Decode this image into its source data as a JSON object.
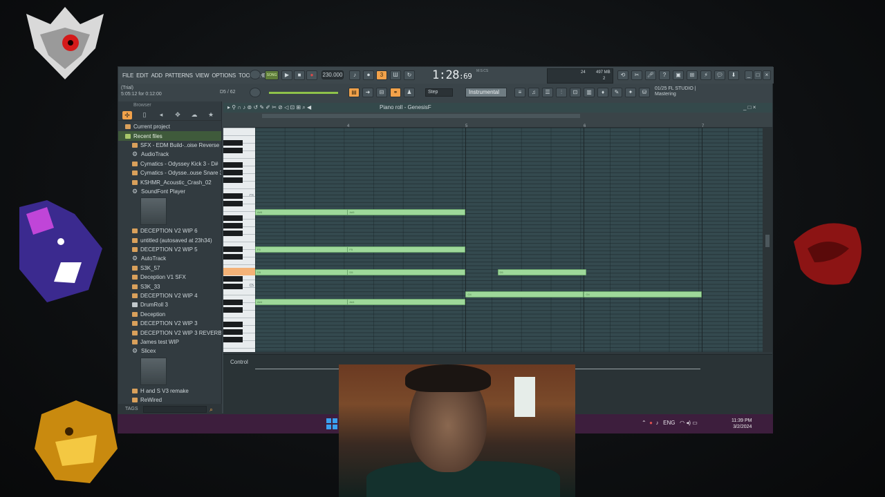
{
  "menu": [
    "FILE",
    "EDIT",
    "ADD",
    "PATTERNS",
    "VIEW",
    "OPTIONS",
    "TOOLS",
    "HELP"
  ],
  "hint": {
    "line1": "(Trial)",
    "line2": "5:05:12 for 0:12:00",
    "counter": "D5 / 62"
  },
  "transport": {
    "song_label": "SONG",
    "tempo": "230.000",
    "time": "1:28",
    "time_fraction": ":69",
    "time_unit": "M:S:CS",
    "cpu_value": "24",
    "memory": "497 MB",
    "voices": "2"
  },
  "toolbar": {
    "step_label": "Step",
    "channel_label": "Instrumental"
  },
  "fl_info": {
    "line1": "01/25  FL STUDIO |",
    "line2": "Mastering"
  },
  "browser": {
    "title": "Browser",
    "items": [
      {
        "type": "folder",
        "icon": "folder-icon",
        "label": "Current project"
      },
      {
        "type": "folder",
        "icon": "folder-green-icon",
        "label": "Recent files",
        "selected": true
      },
      {
        "type": "item",
        "icon": "audio-file-icon",
        "label": "SFX - EDM Build-..oise Reverse 160"
      },
      {
        "type": "item",
        "icon": "gear-icon",
        "label": "AudioTrack"
      },
      {
        "type": "item",
        "icon": "audio-file-icon",
        "label": "Cymatics - Odyssey Kick 3 - D#"
      },
      {
        "type": "item",
        "icon": "audio-file-icon",
        "label": "Cymatics - Odysse..ouse Snare 3 - E"
      },
      {
        "type": "item",
        "icon": "audio-file-icon",
        "label": "KSHMR_Acoustic_Crash_02"
      },
      {
        "type": "item",
        "icon": "gear-icon",
        "label": "SoundFont Player"
      },
      {
        "type": "thumb"
      },
      {
        "type": "item",
        "icon": "project-file-icon",
        "label": "DECEPTION V2 WIP 6"
      },
      {
        "type": "item",
        "icon": "project-file-icon",
        "label": "untitled (autosaved at 23h34)"
      },
      {
        "type": "item",
        "icon": "project-file-icon",
        "label": "DECEPTION V2 WIP 5"
      },
      {
        "type": "item",
        "icon": "gear-icon",
        "label": "AutoTrack"
      },
      {
        "type": "item",
        "icon": "project-file-icon",
        "label": "S3K_57"
      },
      {
        "type": "item",
        "icon": "project-file-icon",
        "label": "Deception V1 SFX"
      },
      {
        "type": "item",
        "icon": "project-file-icon",
        "label": "S3K_33"
      },
      {
        "type": "item",
        "icon": "project-file-icon",
        "label": "DECEPTION V2 WIP 4"
      },
      {
        "type": "item",
        "icon": "doc-icon",
        "label": "DrumRoll 3"
      },
      {
        "type": "item",
        "icon": "project-file-icon",
        "label": "Deception"
      },
      {
        "type": "item",
        "icon": "project-file-icon",
        "label": "DECEPTION V2 WIP 3"
      },
      {
        "type": "item",
        "icon": "project-file-icon",
        "label": "DECEPTION V2 WIP 3 REVERB"
      },
      {
        "type": "item",
        "icon": "project-file-icon",
        "label": "James test WIP"
      },
      {
        "type": "item",
        "icon": "gear-icon",
        "label": "Slicex"
      },
      {
        "type": "thumb"
      },
      {
        "type": "item",
        "icon": "project-file-icon",
        "label": "H and S V3 remake"
      },
      {
        "type": "item",
        "icon": "project-file-icon",
        "label": "ReWired"
      }
    ],
    "tags_label": "TAGS"
  },
  "piano_roll": {
    "title": "Piano roll - GenesisF",
    "bars": [
      "4",
      "5",
      "6",
      "7"
    ],
    "key_labels": [
      "C6",
      "C5"
    ],
    "control_label": "Control",
    "notes": [
      {
        "label": "A#5",
        "start": 0.0,
        "length": 1.0
      },
      {
        "label": "A#5",
        "start": 0.78,
        "length": 1.0
      },
      {
        "label": "F5",
        "start": 0.0,
        "length": 1.0
      },
      {
        "label": "F5",
        "start": 0.78,
        "length": 1.0
      },
      {
        "label": "D5",
        "start": 0.0,
        "length": 1.0
      },
      {
        "label": "D5",
        "start": 0.78,
        "length": 1.0
      },
      {
        "label": "D5",
        "start": 2.05,
        "length": 0.75
      },
      {
        "label": "G4",
        "start": 1.78,
        "length": 1.0
      },
      {
        "label": "G4",
        "start": 2.78,
        "length": 1.0
      },
      {
        "label": "A#4",
        "start": 0.0,
        "length": 1.0
      },
      {
        "label": "A#4",
        "start": 0.78,
        "length": 1.0
      }
    ]
  },
  "taskbar": {
    "lang": "ENG",
    "time": "11:39 PM",
    "date": "3/2/2024"
  }
}
